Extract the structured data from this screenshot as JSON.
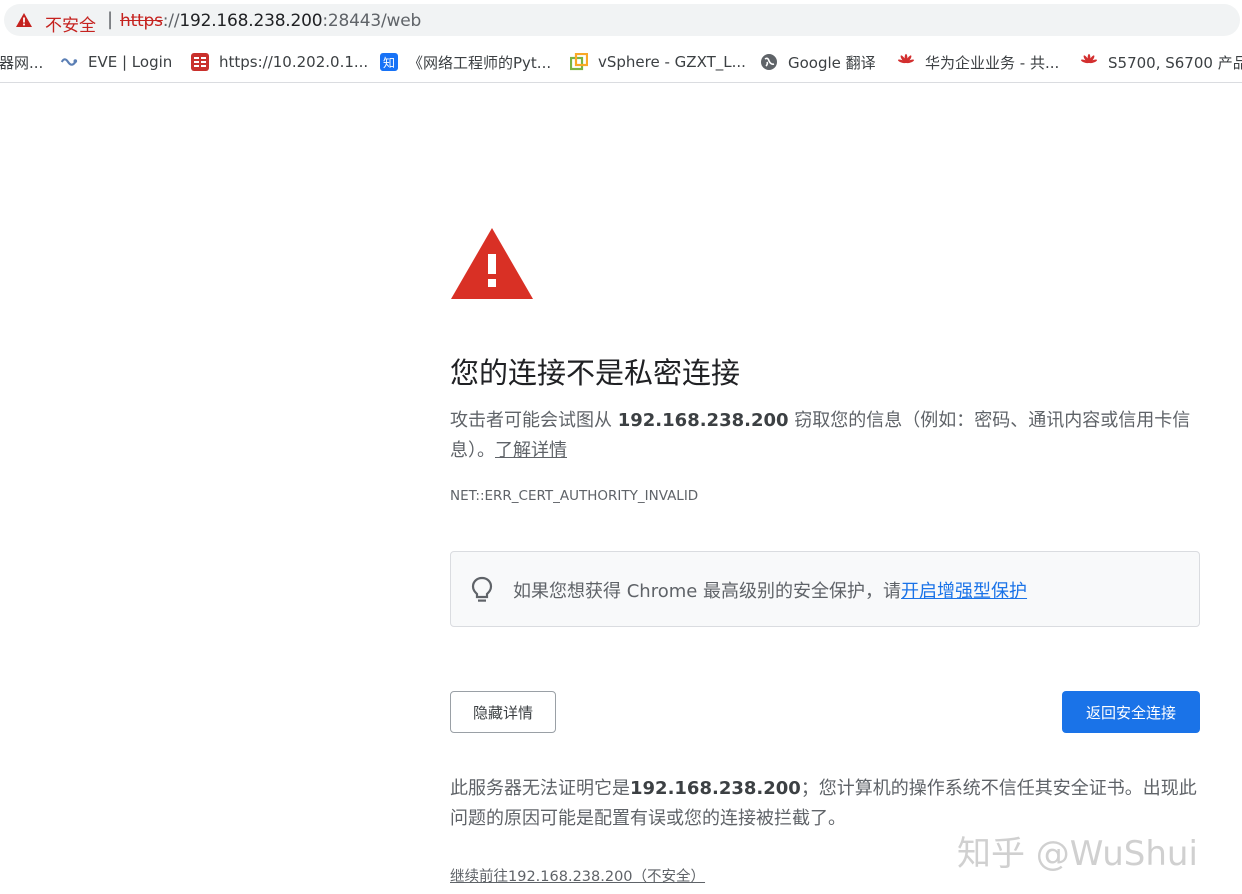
{
  "address_bar": {
    "security_label": "不安全",
    "separator": "|",
    "url_scheme": "https",
    "url_sep": "://",
    "url_host": "192.168.238.200",
    "url_rest": ":28443/web"
  },
  "bookmarks": [
    {
      "label": "器网...",
      "icon": "none"
    },
    {
      "label": "EVE | Login",
      "icon": "eve-icon"
    },
    {
      "label": "https://10.202.0.1...",
      "icon": "fortinet-icon"
    },
    {
      "label": "《网络工程师的Pyt...",
      "icon": "zhihu-icon",
      "icon_text": "知"
    },
    {
      "label": "vSphere - GZXT_L...",
      "icon": "vsphere-icon"
    },
    {
      "label": "Google 翻译",
      "icon": "globe-icon"
    },
    {
      "label": "华为企业业务 - 共...",
      "icon": "huawei-icon"
    },
    {
      "label": "S5700, S6700 产品",
      "icon": "huawei-icon"
    }
  ],
  "main": {
    "heading": "您的连接不是私密连接",
    "body_prefix": "攻击者可能会试图从 ",
    "body_host": "192.168.238.200",
    "body_suffix": " 窃取您的信息（例如：密码、通讯内容或信用卡信息）。",
    "learn_more": "了解详情",
    "error_code": "NET::ERR_CERT_AUTHORITY_INVALID",
    "enhanced_prefix": "如果您想获得 Chrome 最高级别的安全保护，请",
    "enhanced_link": "开启增强型保护",
    "hide_details_button": "隐藏详情",
    "back_button": "返回安全连接",
    "details_prefix": "此服务器无法证明它是",
    "details_host": "192.168.238.200",
    "details_suffix": "；您计算机的操作系统不信任其安全证书。出现此问题的原因可能是配置有误或您的连接被拦截了。",
    "proceed_link": "继续前往192.168.238.200（不安全）"
  },
  "watermark": "知乎 @WuShui",
  "colors": {
    "danger": "#d93025",
    "link": "#1a73e8",
    "primary_button": "#1a73e8",
    "not_secure": "#c5221f"
  }
}
